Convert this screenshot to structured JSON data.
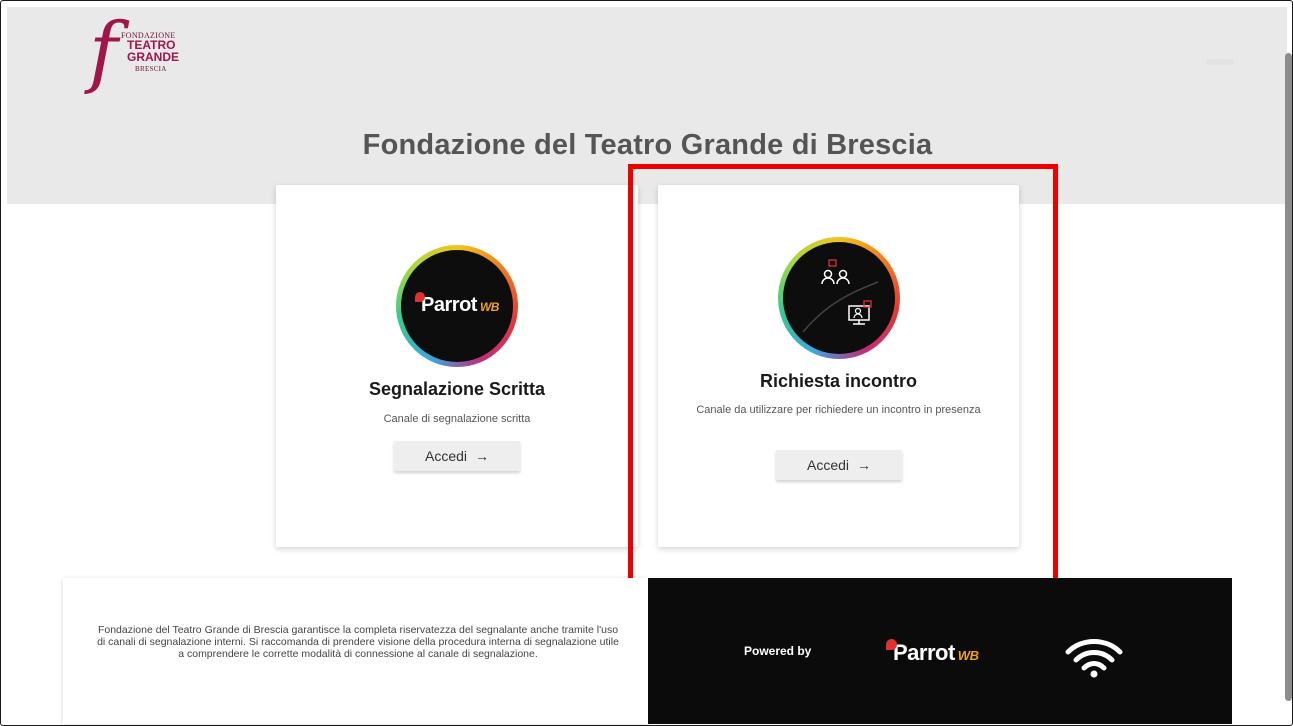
{
  "brand": {
    "logo_letter": "f",
    "logo_line1": "FONDAZIONE",
    "logo_line2": "TEATRO",
    "logo_line3": "GRANDE",
    "logo_line4": "BRESCIA",
    "color": "#a0164a"
  },
  "page": {
    "title": "Fondazione del Teatro Grande di Brescia"
  },
  "cards": [
    {
      "title": "Segnalazione Scritta",
      "description": "Canale di segnalazione scritta",
      "button_label": "Accedi",
      "button_arrow": "→",
      "icon_text": "Parrot",
      "icon_badge": "WB"
    },
    {
      "title": "Richiesta incontro",
      "description": "Canale da utilizzare per richiedere un incontro in presenza",
      "button_label": "Accedi",
      "button_arrow": "→"
    }
  ],
  "footer": {
    "notice": "Fondazione del Teatro Grande di Brescia garantisce la completa riservatezza del segnalante anche tramite l'uso di canali di segnalazione interni. Si raccomanda di prendere visione della procedura interna di segnalazione utile a comprendere le corrette modalità di connessione al canale di segnalazione.",
    "powered_by": "Powered by",
    "parrot_text": "Parrot",
    "parrot_badge": "WB"
  },
  "colors": {
    "highlight": "#ee0000",
    "header_bg": "#e9e9e9",
    "footer_dark": "#0b0b0b"
  }
}
